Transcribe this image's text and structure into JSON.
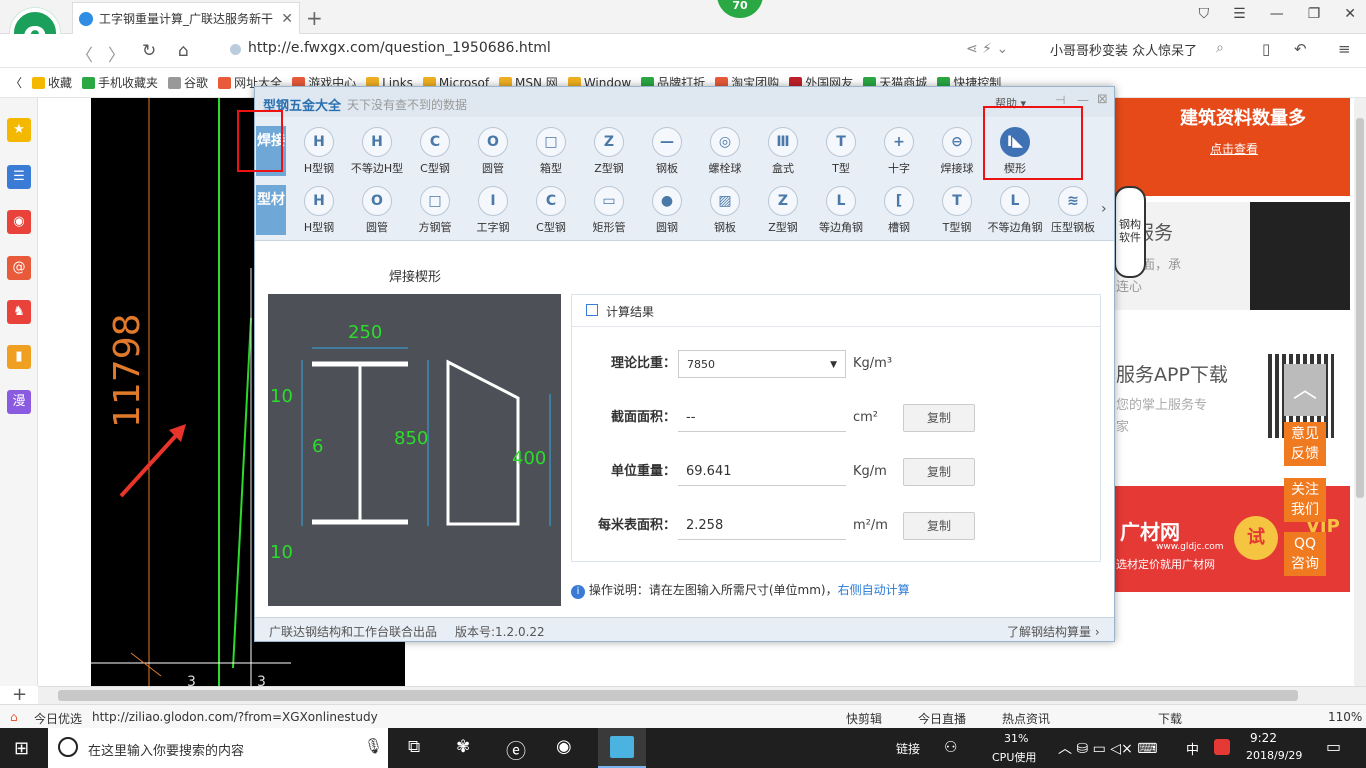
{
  "browser": {
    "tab_title": "工字钢重量计算_广联达服务新干",
    "badge": "70",
    "url": "http://e.fwxgx.com/question_1950686.html",
    "news": "小哥哥秒变装 众人惊呆了",
    "favorites": [
      "收藏",
      "手机收藏夹",
      "谷歌",
      "网址大全",
      "游戏中心",
      "Links",
      "Microsof",
      "MSN 网",
      "Window",
      "品牌打折",
      "淘宝团购",
      "外国网友",
      "天猫商城",
      "快捷控制"
    ]
  },
  "cad": {
    "dimension": "11798",
    "bottom_left": "3",
    "bottom_right": "3"
  },
  "app": {
    "title": "型钢五金大全",
    "subtitle": "天下没有查不到的数据",
    "help": "帮助",
    "cat_weld": "焊接",
    "cat_profile": "型材",
    "weld_tools": [
      {
        "icon": "H",
        "label": "H型钢"
      },
      {
        "icon": "H",
        "label": "不等边H型"
      },
      {
        "icon": "C",
        "label": "C型钢"
      },
      {
        "icon": "O",
        "label": "圆管"
      },
      {
        "icon": "□",
        "label": "箱型"
      },
      {
        "icon": "Z",
        "label": "Z型钢"
      },
      {
        "icon": "—",
        "label": "钢板"
      },
      {
        "icon": "◎",
        "label": "螺栓球"
      },
      {
        "icon": "Ⅲ",
        "label": "盒式"
      },
      {
        "icon": "T",
        "label": "T型"
      },
      {
        "icon": "+",
        "label": "十字"
      },
      {
        "icon": "⊖",
        "label": "焊接球"
      },
      {
        "icon": "I◣",
        "label": "楔形"
      }
    ],
    "profile_tools": [
      {
        "icon": "H",
        "label": "H型钢"
      },
      {
        "icon": "O",
        "label": "圆管"
      },
      {
        "icon": "□",
        "label": "方钢管"
      },
      {
        "icon": "I",
        "label": "工字钢"
      },
      {
        "icon": "C",
        "label": "C型钢"
      },
      {
        "icon": "▭",
        "label": "矩形管"
      },
      {
        "icon": "●",
        "label": "圆钢"
      },
      {
        "icon": "▨",
        "label": "钢板"
      },
      {
        "icon": "Z",
        "label": "Z型钢"
      },
      {
        "icon": "L",
        "label": "等边角钢"
      },
      {
        "icon": "[",
        "label": "槽钢"
      },
      {
        "icon": "T",
        "label": "T型钢"
      },
      {
        "icon": "L",
        "label": "不等边角钢"
      },
      {
        "icon": "≋",
        "label": "压型钢板"
      }
    ],
    "section_title": "焊接楔形",
    "dims": {
      "top_width": "250",
      "top_flange": "10",
      "web": "6",
      "height": "850",
      "bottom_flange": "10",
      "end_height": "400"
    },
    "result_title": "计算结果",
    "density_label": "理论比重：",
    "density_value": "7850",
    "density_unit": "Kg/m³",
    "area_label": "截面面积：",
    "area_value": "--",
    "area_unit": "cm²",
    "weight_label": "单位重量：",
    "weight_value": "69.641",
    "weight_unit": "Kg/m",
    "surface_label": "每米表面积：",
    "surface_value": "2.258",
    "surface_unit": "m²/m",
    "copy_label": "复制",
    "tip": "操作说明：请在左图输入所需尺寸(单位mm)，",
    "tip_link": "右侧自动计算",
    "footer_left": "广联达钢结构和工作台联合出品",
    "version": "版本号:1.2.0.22",
    "footer_right": "了解钢结构算量"
  },
  "rightpage": {
    "banner1": "建筑资料数量多",
    "banner1_btn": "点击查看",
    "service": "构服务",
    "service_sub1": "面对面，承",
    "service_sub2": "连心",
    "mascot": "钢构软件",
    "app_title": "服务APP下载",
    "app_sub1": "您的掌上服务专",
    "app_sub2": "家",
    "feedback": "意见反馈",
    "follow": "关注我们",
    "qq": "QQ咨询",
    "ad_brand": "广材网",
    "ad_url": "www.gldjc.com",
    "ad_slogan": "选材定价就用广材网",
    "ad_try": "试",
    "ad_vip": "VIP"
  },
  "status": {
    "left": "今日优选",
    "url": "http://ziliao.glodon.com/?from=XGXonlinestudy",
    "items": [
      "快剪辑",
      "今日直播",
      "热点资讯",
      "下载"
    ],
    "zoom": "110%"
  },
  "taskbar": {
    "search": "在这里输入你要搜索的内容",
    "link": "链接",
    "cpu": "31%",
    "cpu_label": "CPU使用",
    "ime": "中",
    "time": "9:22",
    "date": "2018/9/29"
  }
}
